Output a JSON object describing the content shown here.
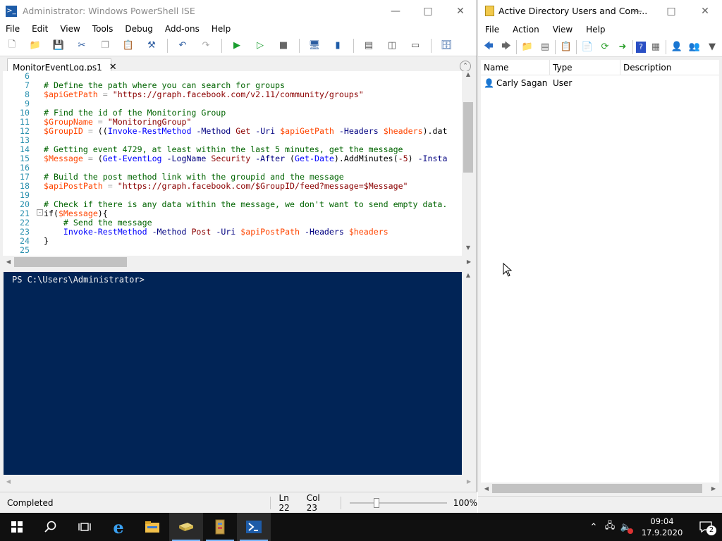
{
  "ise": {
    "title": "Administrator: Windows PowerShell ISE",
    "menu": [
      "File",
      "Edit",
      "View",
      "Tools",
      "Debug",
      "Add-ons",
      "Help"
    ],
    "tab_label": "MonitorEventLog.ps1",
    "code_lines": [
      {
        "n": "6",
        "html": ""
      },
      {
        "n": "7",
        "html": "<span class='c-com'># Define the path where you can search for groups</span>"
      },
      {
        "n": "8",
        "html": "<span class='c-var'>$apiGetPath</span> <span class='c-op'>=</span> <span class='c-str'>\"https://graph.facebook.com/v2.11/community/groups\"</span>"
      },
      {
        "n": "9",
        "html": ""
      },
      {
        "n": "10",
        "html": "<span class='c-com'># Find the id of the Monitoring Group</span>"
      },
      {
        "n": "11",
        "html": "<span class='c-var'>$GroupName</span> <span class='c-op'>=</span> <span class='c-str'>\"MonitoringGroup\"</span>"
      },
      {
        "n": "12",
        "html": "<span class='c-var'>$GroupID</span> <span class='c-op'>=</span> ((<span class='c-cmd'>Invoke-RestMethod</span> <span class='c-par'>-Method</span> <span class='c-str'>Get</span> <span class='c-par'>-Uri</span> <span class='c-var'>$apiGetPath</span> <span class='c-par'>-Headers</span> <span class='c-var'>$headers</span>).dat"
      },
      {
        "n": "13",
        "html": ""
      },
      {
        "n": "14",
        "html": "<span class='c-com'># Getting event 4729, at least within the last 5 minutes, get the message</span>"
      },
      {
        "n": "15",
        "html": "<span class='c-var'>$Message</span> <span class='c-op'>=</span> (<span class='c-cmd'>Get-EventLog</span> <span class='c-par'>-LogName</span> <span class='c-str'>Security</span> <span class='c-par'>-After</span> (<span class='c-cmd'>Get-Date</span>).AddMinutes(<span class='c-str'>-5</span>) <span class='c-par'>-Insta</span>"
      },
      {
        "n": "16",
        "html": ""
      },
      {
        "n": "17",
        "html": "<span class='c-com'># Build the post method link with the groupid and the message</span>"
      },
      {
        "n": "18",
        "html": "<span class='c-var'>$apiPostPath</span> <span class='c-op'>=</span> <span class='c-str'>\"https://graph.facebook.com/$GroupID/feed?message=$Message\"</span>"
      },
      {
        "n": "19",
        "html": ""
      },
      {
        "n": "20",
        "html": "<span class='c-com'># Check if there is any data within the message, we don't want to send empty data.</span>"
      },
      {
        "n": "21",
        "html": "if(<span class='c-var'>$Message</span>){"
      },
      {
        "n": "22",
        "html": "    <span class='c-com'># Send the message</span>"
      },
      {
        "n": "23",
        "html": "    <span class='c-cmd'>Invoke-RestMethod</span> <span class='c-par'>-Method</span> <span class='c-str'>Post</span> <span class='c-par'>-Uri</span> <span class='c-var'>$apiPostPath</span> <span class='c-par'>-Headers</span> <span class='c-var'>$headers</span>"
      },
      {
        "n": "24",
        "html": "}"
      },
      {
        "n": "25",
        "html": ""
      }
    ],
    "console_prompt": "PS C:\\Users\\Administrator>",
    "status": {
      "state": "Completed",
      "line": "Ln 22",
      "col": "Col 23",
      "zoom": "100%"
    }
  },
  "aduc": {
    "title": "Active Directory Users and Com...",
    "menu": [
      "File",
      "Action",
      "View",
      "Help"
    ],
    "columns": [
      "Name",
      "Type",
      "Description"
    ],
    "rows": [
      {
        "name": "Carly Sagan",
        "type": "User",
        "description": ""
      }
    ]
  },
  "taskbar": {
    "time": "09:04",
    "date": "17.9.2020",
    "notification_count": "2"
  },
  "colors": {
    "console_bg": "#012456",
    "taskbar_bg": "#101010"
  }
}
